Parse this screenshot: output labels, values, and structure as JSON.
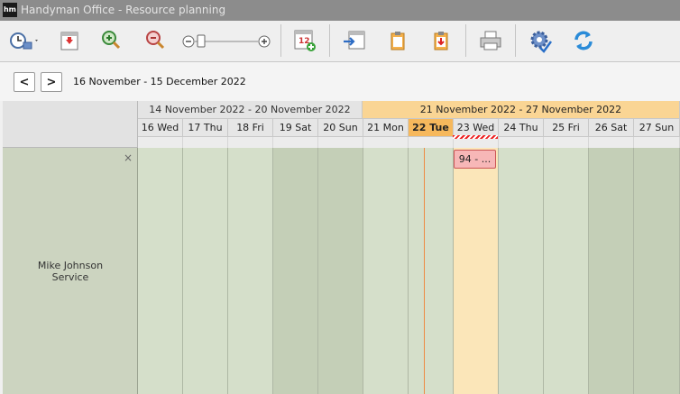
{
  "app": {
    "logo_text": "hm",
    "title": "Handyman Office - Resource planning"
  },
  "toolbar": {
    "buttons": [
      {
        "name": "view-mode-icon"
      },
      {
        "name": "go-to-date-icon"
      },
      {
        "name": "zoom-in-icon"
      },
      {
        "name": "zoom-out-icon"
      },
      {
        "name": "zoom-slider"
      },
      {
        "name": "new-appointment-icon"
      },
      {
        "name": "move-appointment-icon"
      },
      {
        "name": "clipboard-icon"
      },
      {
        "name": "clipboard-import-icon"
      },
      {
        "name": "print-icon"
      },
      {
        "name": "settings-icon"
      },
      {
        "name": "refresh-icon"
      }
    ],
    "zoom_level_fraction": 0.2
  },
  "navigation": {
    "prev_label": "<",
    "next_label": ">",
    "date_range": "16 November - 15 December 2022"
  },
  "weeks": [
    {
      "label": "14 November 2022 - 20 November 2022",
      "highlighted": false
    },
    {
      "label": "21 November 2022 - 27 November 2022",
      "highlighted": true
    }
  ],
  "days": [
    {
      "label": "16 Wed",
      "type": "weekday"
    },
    {
      "label": "17 Thu",
      "type": "weekday"
    },
    {
      "label": "18 Fri",
      "type": "weekday"
    },
    {
      "label": "19 Sat",
      "type": "weekend"
    },
    {
      "label": "20 Sun",
      "type": "weekend"
    },
    {
      "label": "21 Mon",
      "type": "weekday"
    },
    {
      "label": "22 Tue",
      "type": "today"
    },
    {
      "label": "23 Wed",
      "type": "selected"
    },
    {
      "label": "24 Thu",
      "type": "weekday"
    },
    {
      "label": "25 Fri",
      "type": "weekday"
    },
    {
      "label": "26 Sat",
      "type": "weekend"
    },
    {
      "label": "27 Sun",
      "type": "weekend"
    }
  ],
  "resource": {
    "name": "Mike Johnson",
    "department": "Service",
    "close_symbol": "×"
  },
  "appointments": [
    {
      "label": "94 - ...",
      "day": "23 Wed",
      "color": "#f7b7b7"
    }
  ],
  "colors": {
    "accent_week": "#fad594",
    "today": "#f6b85c",
    "weekday_col": "#d5dfca",
    "weekend_col": "#c4cfb7",
    "now_line": "#ee8a44"
  }
}
